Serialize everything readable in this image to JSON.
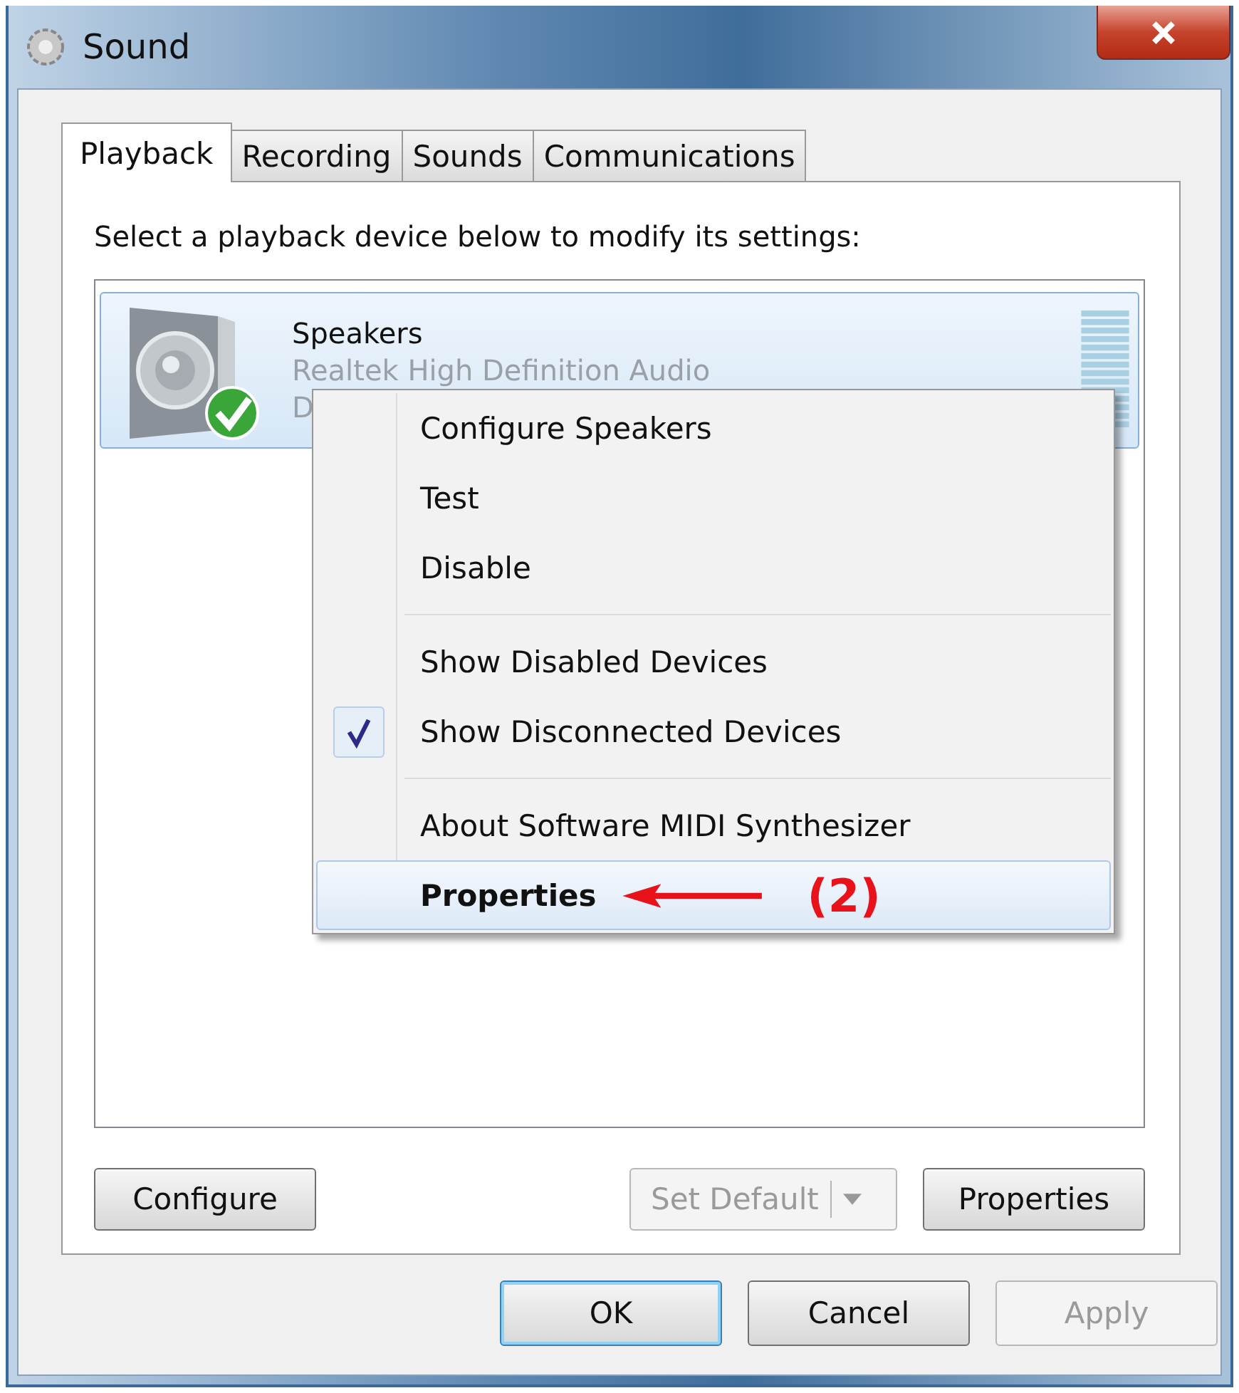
{
  "window": {
    "title": "Sound"
  },
  "tabs": [
    {
      "label": "Playback",
      "selected": true
    },
    {
      "label": "Recording",
      "selected": false
    },
    {
      "label": "Sounds",
      "selected": false
    },
    {
      "label": "Communications",
      "selected": false
    }
  ],
  "instruction": "Select a playback device below to modify its settings:",
  "devices": [
    {
      "name": "Speakers",
      "driver": "Realtek High Definition Audio",
      "status": "D",
      "selected": true,
      "is_default": true
    }
  ],
  "context_menu": {
    "items": [
      {
        "kind": "item",
        "label": "Configure Speakers",
        "checked": false,
        "selected": false,
        "default": false
      },
      {
        "kind": "item",
        "label": "Test",
        "checked": false,
        "selected": false,
        "default": false
      },
      {
        "kind": "item",
        "label": "Disable",
        "checked": false,
        "selected": false,
        "default": false
      },
      {
        "kind": "separator"
      },
      {
        "kind": "item",
        "label": "Show Disabled Devices",
        "checked": false,
        "selected": false,
        "default": false
      },
      {
        "kind": "item",
        "label": "Show Disconnected Devices",
        "checked": true,
        "selected": false,
        "default": false
      },
      {
        "kind": "separator"
      },
      {
        "kind": "item",
        "label": "About Software MIDI Synthesizer",
        "checked": false,
        "selected": false,
        "default": false
      },
      {
        "kind": "item",
        "label": "Properties",
        "checked": false,
        "selected": true,
        "default": true
      }
    ],
    "annotation": "(2)"
  },
  "panel_buttons": [
    {
      "kind": "button",
      "label": "Configure",
      "disabled": false
    },
    {
      "kind": "split",
      "label": "Set Default",
      "disabled": true
    },
    {
      "kind": "button",
      "label": "Properties",
      "disabled": false
    }
  ],
  "dialog_buttons": [
    {
      "label": "OK",
      "disabled": false,
      "focused": true
    },
    {
      "label": "Cancel",
      "disabled": false,
      "focused": false
    },
    {
      "label": "Apply",
      "disabled": true,
      "focused": false
    }
  ]
}
